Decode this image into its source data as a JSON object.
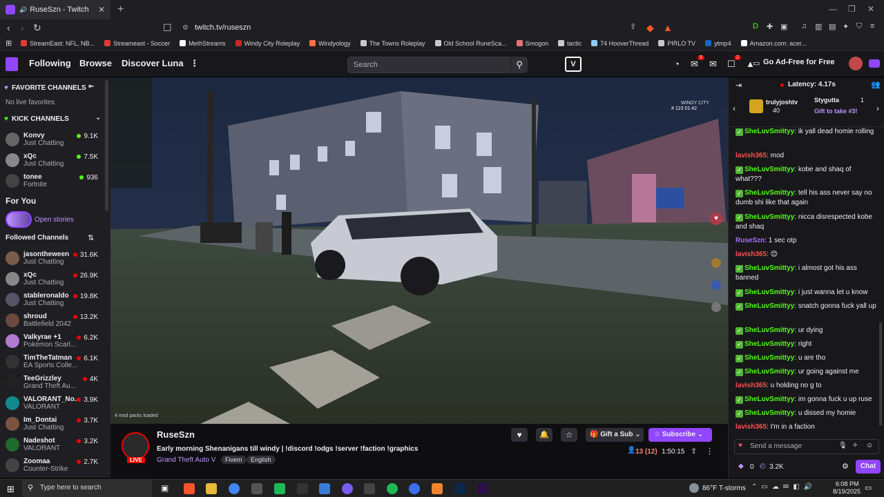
{
  "browser": {
    "tab_title": "RuseSzn - Twitch",
    "url": "twitch.tv/ruseszn",
    "bookmarks": [
      "StreamEast: NFL, NB...",
      "Streameast - Soccer",
      "MethStreams",
      "Windy City Roleplay",
      "Windyology",
      "The Towns Roleplay",
      "Old School RuneSca...",
      "Smogon",
      "tactic",
      "74 HooverThread",
      "PIRLO TV",
      "ytmp4",
      "Amazon.com: acer..."
    ]
  },
  "nav": {
    "following": "Following",
    "browse": "Browse",
    "discover": "Discover Luna",
    "search_placeholder": "Search",
    "notif_badge_1": "5",
    "notif_badge_2": "2",
    "ad_free": "Go Ad-Free for Free"
  },
  "sidebar": {
    "favorite_header": "FAVORITE CHANNELS",
    "no_live": "No live favorites",
    "kick_header": "KICK CHANNELS",
    "kick_channels": [
      {
        "name": "Konvy",
        "game": "Just Chatting",
        "viewers": "9.1K"
      },
      {
        "name": "xQc",
        "game": "Just Chatting",
        "viewers": "7.5K"
      },
      {
        "name": "tonee",
        "game": "Fortnite",
        "viewers": "936"
      }
    ],
    "for_you": "For You",
    "open_stories": "Open stories",
    "followed_header": "Followed Channels",
    "followed": [
      {
        "name": "jasontheween",
        "game": "Just Chatting",
        "viewers": "31.6K"
      },
      {
        "name": "xQc",
        "game": "Just Chatting",
        "viewers": "26.9K"
      },
      {
        "name": "stableronaldo",
        "game": "Just Chatting",
        "viewers": "19.8K"
      },
      {
        "name": "shroud",
        "game": "Battlefield 2042",
        "viewers": "13.2K"
      },
      {
        "name": "Valkyrae +1",
        "game": "Pokémon Scarl...",
        "viewers": "6.2K"
      },
      {
        "name": "TimTheTatman",
        "game": "EA Sports Colle...",
        "viewers": "6.1K"
      },
      {
        "name": "TeeGrizzley",
        "game": "Grand Theft Au...",
        "viewers": "4K"
      },
      {
        "name": "VALORANT_No...",
        "game": "VALORANT",
        "viewers": "3.9K"
      },
      {
        "name": "Im_Dontai",
        "game": "Just Chatting",
        "viewers": "3.7K"
      },
      {
        "name": "Nadeshot",
        "game": "VALORANT",
        "viewers": "3.2K"
      },
      {
        "name": "Zoomaa",
        "game": "Counter-Strike",
        "viewers": "2.7K"
      }
    ]
  },
  "video": {
    "overlay_top": "WINDY CITY",
    "overlay_stats": "# 123   01:42",
    "overlay_bottom_left": "4 mod packs loaded"
  },
  "stream": {
    "channel": "RuseSzn",
    "live": "LIVE",
    "title": "Early morning Shenanigans till windy | !discord !odgs !server !faction !graphics",
    "game": "Grand Theft Auto V",
    "tags": [
      "Fivem",
      "English"
    ],
    "viewers": "13 (12)",
    "uptime": "1:50:15",
    "gift_sub": "Gift a Sub",
    "subscribe": "Subscribe"
  },
  "chat": {
    "latency": "Latency: 4.17s",
    "hype_user1": "trulyjoshtv",
    "hype_count1": "40",
    "hype_user2": "Stygutta",
    "hype_count2": "1",
    "hype_gift": "Gift to take #3!",
    "messages": [
      {
        "user": "SheLuvSmittyy",
        "text": "ik yall dead homie rolling",
        "color": "#53fc18",
        "check": true
      },
      {
        "user": "lavish365",
        "text": "mod",
        "color": "#ff4f4f",
        "check": false
      },
      {
        "user": "SheLuvSmittyy",
        "text": "kobe and shaq of what???",
        "color": "#53fc18",
        "check": true
      },
      {
        "user": "SheLuvSmittyy",
        "text": "tell his ass never say no dumb shi like that again",
        "color": "#53fc18",
        "check": true
      },
      {
        "user": "SheLuvSmittyy",
        "text": "nicca disrespected kobe and shaq",
        "color": "#53fc18",
        "check": true
      },
      {
        "user": "RuseSzn",
        "text": "1 sec otp",
        "color": "#a970ff",
        "check": false
      },
      {
        "user": "lavish365",
        "text": "😊",
        "color": "#ff4f4f",
        "check": false
      },
      {
        "user": "SheLuvSmittyy",
        "text": "i almost got his ass banned",
        "color": "#53fc18",
        "check": true
      },
      {
        "user": "SheLuvSmittyy",
        "text": "i just wanna let u know",
        "color": "#53fc18",
        "check": true
      },
      {
        "user": "SheLuvSmittyy",
        "text": "snatch gonna fuck yall up",
        "color": "#53fc18",
        "check": true
      },
      {
        "user": "SheLuvSmittyy",
        "text": "ur dying",
        "color": "#53fc18",
        "check": true
      },
      {
        "user": "SheLuvSmittyy",
        "text": "right",
        "color": "#53fc18",
        "check": true
      },
      {
        "user": "SheLuvSmittyy",
        "text": "u are tho",
        "color": "#53fc18",
        "check": true
      },
      {
        "user": "SheLuvSmittyy",
        "text": "ur going against me",
        "color": "#53fc18",
        "check": true
      },
      {
        "user": "lavish365",
        "text": "u holding no g to",
        "color": "#ff4f4f",
        "check": false
      },
      {
        "user": "SheLuvSmittyy",
        "text": "im gonna fuck u up ruse",
        "color": "#53fc18",
        "check": true
      },
      {
        "user": "SheLuvSmittyy",
        "text": "u dissed my homie",
        "color": "#53fc18",
        "check": true
      },
      {
        "user": "lavish365",
        "text": "I'm in a faction",
        "color": "#ff4f4f",
        "check": false
      }
    ],
    "input_placeholder": "Send a message",
    "points": "0",
    "bits": "3.2K",
    "chat_btn": "Chat"
  },
  "taskbar": {
    "search_placeholder": "Type here to search",
    "weather": "86°F  T-storms",
    "time": "6:08 PM",
    "date": "8/19/2025"
  }
}
